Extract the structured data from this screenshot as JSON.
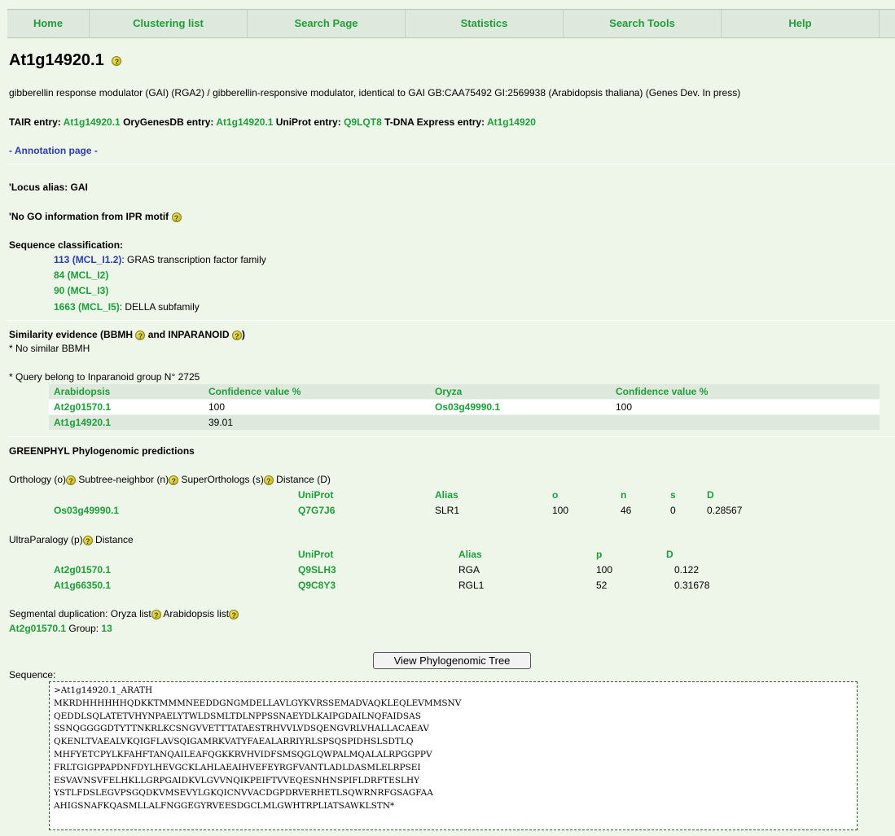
{
  "nav": [
    "Home",
    "Clustering list",
    "Search Page",
    "Statistics",
    "Search Tools",
    "Help"
  ],
  "title": "At1g14920.1",
  "description": "gibberellin response modulator (GAI) (RGA2) / gibberellin-responsive modulator, identical to GAI GB:CAA75492 GI:2569938 (Arabidopsis thaliana) (Genes Dev. In press)",
  "entries": {
    "tair_label": "TAIR entry:",
    "tair_value": "At1g14920.1",
    "ory_label": "OryGenesDB entry:",
    "ory_value": "At1g14920.1",
    "uniprot_label": "UniProt entry:",
    "uniprot_value": "Q9LQT8",
    "tdna_label": "T-DNA Express entry:",
    "tdna_value": "At1g14920"
  },
  "annotation_link": "- Annotation page -",
  "locus_alias": "'Locus alias: GAI",
  "no_go": "'No GO information from IPR motif",
  "seq_class": {
    "heading": "Sequence classification:",
    "items": [
      {
        "link": "113 (MCL_I1.2)",
        "text": ": GRAS transcription factor family",
        "blue": true
      },
      {
        "link": "84 (MCL_I2)",
        "text": "",
        "blue": false
      },
      {
        "link": "90 (MCL_I3)",
        "text": "",
        "blue": false
      },
      {
        "link": "1663 (MCL_I5)",
        "text": ": DELLA subfamily",
        "blue": false
      }
    ]
  },
  "similarity": {
    "heading_a": "Similarity evidence (BBMH",
    "heading_b": "and INPARANOID",
    "heading_c": ")",
    "no_bbmh": "* No similar BBMH",
    "query": "* Query belong to Inparanoid group N° 2725",
    "headers": [
      "Arabidopsis",
      "Confidence value %",
      "Oryza",
      "Confidence value %"
    ],
    "rows": [
      [
        "At2g01570.1",
        "100",
        "Os03g49990.1",
        "100"
      ],
      [
        "At1g14920.1",
        "39.01",
        "",
        ""
      ]
    ]
  },
  "greenphyl": {
    "heading": "GREENPHYL Phylogenomic predictions",
    "orth_a": "Orthology (o)",
    "orth_b": "Subtree-neighbor (n)",
    "orth_c": "SuperOrthologs (s)",
    "orth_d": "Distance (D)",
    "orth_headers": [
      "UniProt",
      "Alias",
      "o",
      "n",
      "s",
      "D"
    ],
    "orth_row": [
      "Os03g49990.1",
      "Q7G7J6",
      "SLR1",
      "100",
      "46",
      "0",
      "0.28567"
    ],
    "para_a": "UltraParalogy (p)",
    "para_b": "Distance",
    "para_headers": [
      "UniProt",
      "Alias",
      "p",
      "D"
    ],
    "para_rows": [
      [
        "At2g01570.1",
        "Q9SLH3",
        "RGA",
        "100",
        "0.122"
      ],
      [
        "At1g66350.1",
        "Q9C8Y3",
        "RGL1",
        "52",
        "0.31678"
      ]
    ],
    "seg_a": "Segmental duplication: Oryza list",
    "seg_b": "Arabidopsis list",
    "seg_id": "At2g01570.1",
    "seg_group_label": "Group:",
    "seg_group": "13"
  },
  "button": "View Phylogenomic Tree",
  "sequence_label": "Sequence:",
  "sequence": [
    ">At1g14920.1_ARATH",
    "MKRDHHHHHHQDKKTMMMNEEDDGNGMDELLAVLGYKVRSSEMADVAQKLEQLEVMMSNV",
    "QEDDLSQLATETVHYNPAELYTWLDSMLTDLNPPSSNAEYDLKAIPGDAILNQFAIDSAS",
    "SSNQGGGGDTYTTNKRLKCSNGVVETTTATAESTRHVVLVDSQENGVRLVHALLACAEAV",
    "QKENLTVAEALVKQIGFLAVSQIGAMRKVATYFAEALARRIYRLSPSQSPIDHSLSDTLQ",
    "MHFYETCPYLKFAHFTANQAILEAFQGKKRVHVIDFSMSQGLQWPALMQALALRPGGPPV",
    "FRLTGIGPPAPDNFDYLHEVGCKLAHLAEAIHVEFEYRGFVANTLADLDASMLELRPSEI",
    "ESVAVNSVFELHKLLGRPGAIDKVLGVVNQIKPEIFTVVEQESNHNSPIFLDRFTESLHY",
    "YSTLFDSLEGVPSGQDKVMSEVYLGKQICNVVACDGPDRVERHETLSQWRNRFGSAGFAA",
    "AHIGSNAFKQASMLLALFNGGEGYRVEESDGCLMLGWHTRPLIATSAWKLSTN*"
  ],
  "help_glyph": "?"
}
